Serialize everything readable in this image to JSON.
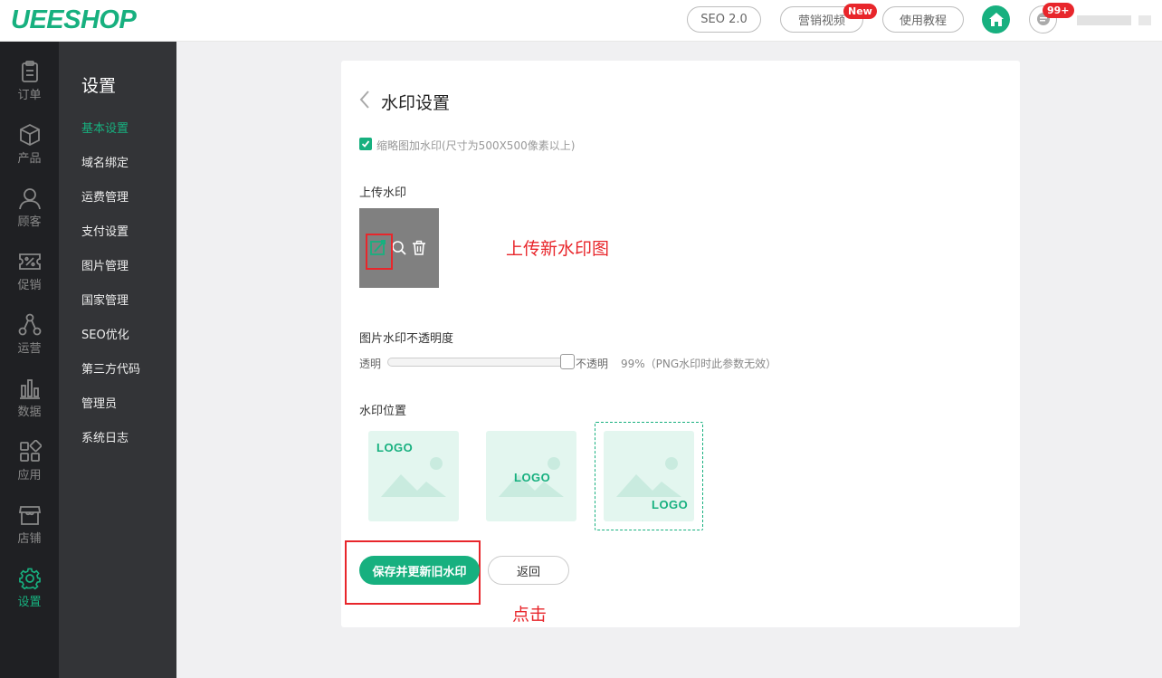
{
  "header": {
    "logo": "UEESHOP",
    "seo_button": "SEO 2.0",
    "video_button": "营销视频",
    "video_badge": "New",
    "tutorial_button": "使用教程",
    "message_badge": "99+"
  },
  "rail": {
    "items": [
      {
        "label": "订单",
        "icon": "clipboard-icon"
      },
      {
        "label": "产品",
        "icon": "box-icon"
      },
      {
        "label": "顾客",
        "icon": "user-icon"
      },
      {
        "label": "促销",
        "icon": "percent-ticket-icon"
      },
      {
        "label": "运营",
        "icon": "network-icon"
      },
      {
        "label": "数据",
        "icon": "bar-chart-icon"
      },
      {
        "label": "应用",
        "icon": "apps-icon"
      },
      {
        "label": "店铺",
        "icon": "store-icon"
      },
      {
        "label": "设置",
        "icon": "gear-icon"
      }
    ],
    "active_index": 8
  },
  "sidebar": {
    "title": "设置",
    "items": [
      {
        "label": "基本设置"
      },
      {
        "label": "域名绑定"
      },
      {
        "label": "运费管理"
      },
      {
        "label": "支付设置"
      },
      {
        "label": "图片管理"
      },
      {
        "label": "国家管理"
      },
      {
        "label": "SEO优化"
      },
      {
        "label": "第三方代码"
      },
      {
        "label": "管理员"
      },
      {
        "label": "系统日志"
      }
    ],
    "active_index": 0
  },
  "main": {
    "title": "水印设置",
    "thumbnail_checkbox_label": "缩略图加水印(尺寸为500X500像素以上)",
    "thumbnail_checked": true,
    "upload_label": "上传水印",
    "upload_annotation": "上传新水印图",
    "opacity_label": "图片水印不透明度",
    "opacity_left": "透明",
    "opacity_right": "不透明",
    "opacity_value": "99%",
    "opacity_note": "99%（PNG水印时此参数无效）",
    "position_label": "水印位置",
    "positions": [
      {
        "logo": "LOGO",
        "placement": "top-left"
      },
      {
        "logo": "LOGO",
        "placement": "center"
      },
      {
        "logo": "LOGO",
        "placement": "bottom-right"
      }
    ],
    "selected_position_index": 2,
    "save_button": "保存并更新旧水印",
    "back_button": "返回",
    "click_annotation": "点击"
  },
  "colors": {
    "accent": "#17b07f",
    "annotation_red": "#e8262b",
    "rail_bg": "#1f2023",
    "sidebar_bg": "#333437"
  }
}
